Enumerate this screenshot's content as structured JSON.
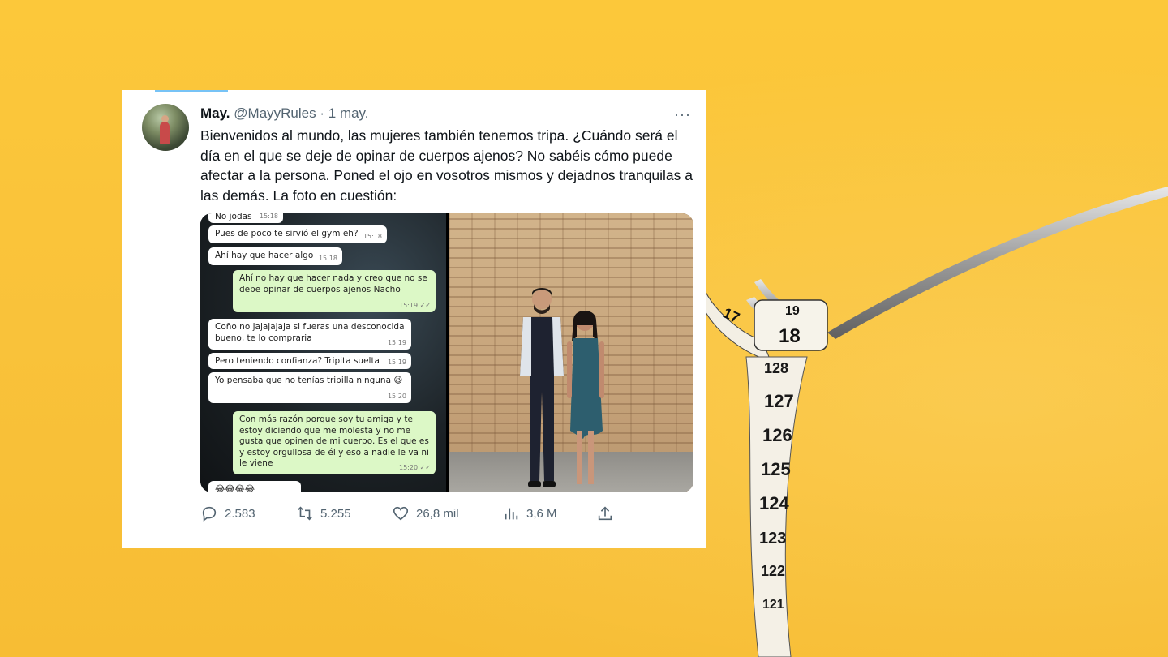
{
  "tweet": {
    "author_name": "May.",
    "handle": "@MayyRules",
    "separator": "·",
    "date": "1 may.",
    "more_icon": "···",
    "text": "Bienvenidos al mundo, las mujeres también tenemos tripa. ¿Cuándo será el día en el que se deje de opinar de cuerpos ajenos? No sabéis cómo puede afectar a la persona. Poned el ojo en vosotros mismos y dejadnos tranquilas a las demás. La foto en cuestión:",
    "actions": {
      "replies": "2.583",
      "retweets": "5.255",
      "likes": "26,8 mil",
      "views": "3,6 M"
    }
  },
  "chat": {
    "messages": [
      {
        "text": "No jodas",
        "time": "15:18",
        "dir": "in"
      },
      {
        "text": "Pues de poco te sirvió el gym eh?",
        "time": "15:18",
        "dir": "in"
      },
      {
        "text": "Ahí hay que hacer algo",
        "time": "15:18",
        "dir": "in"
      },
      {
        "text": "Ahí no hay que hacer nada y creo que no se debe opinar de cuerpos ajenos Nacho",
        "time": "15:19 ✓✓",
        "dir": "out"
      },
      {
        "text": "Coño no jajajajaja si fueras una desconocida bueno, te lo compraria",
        "time": "15:19",
        "dir": "in"
      },
      {
        "text": "Pero teniendo confianza? Tripita suelta",
        "time": "15:19",
        "dir": "in"
      },
      {
        "text": "Yo pensaba que no tenías tripilla ninguna 😆",
        "time": "15:20",
        "dir": "in"
      },
      {
        "text": "Con más razón porque soy tu amiga y te estoy diciendo que me molesta y no me gusta que opinen de mi cuerpo. Es el que es y estoy orgullosa de él y eso a nadie le va ni le viene",
        "time": "15:20 ✓✓",
        "dir": "out"
      },
      {
        "text": "😂😂😂😂",
        "time": "",
        "dir": "in"
      }
    ]
  },
  "tape_numbers": [
    "17",
    "18",
    "19",
    "128",
    "127",
    "126",
    "125",
    "124",
    "123",
    "122",
    "121"
  ],
  "colors": {
    "background": "#f9c23a",
    "link_blue": "#1d9bf0",
    "text_gray": "#536471",
    "chat_out": "#dcf8c6"
  },
  "icons": [
    "reply-icon",
    "retweet-icon",
    "like-icon",
    "views-icon",
    "share-icon"
  ]
}
